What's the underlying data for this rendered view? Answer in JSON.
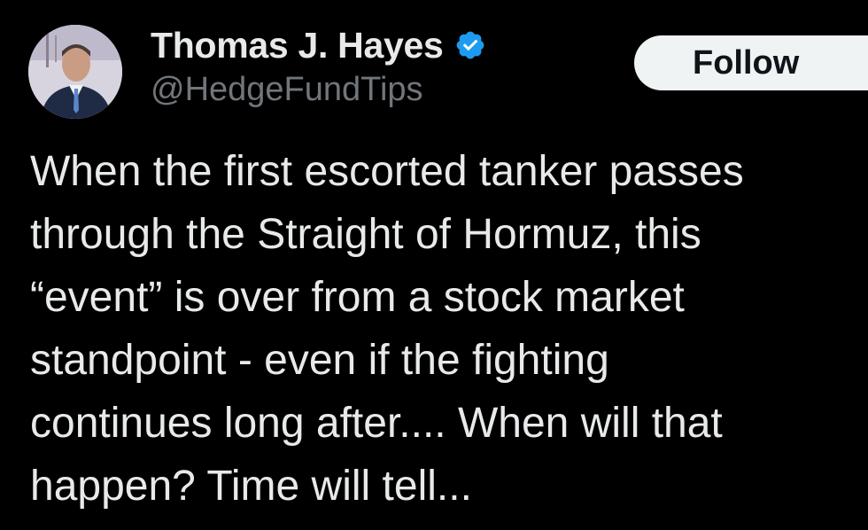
{
  "author": {
    "display_name": "Thomas J. Hayes",
    "handle": "@HedgeFundTips",
    "verified_icon": "verified-badge-icon",
    "avatar_icon": "avatar-photo"
  },
  "follow": {
    "label": "Follow"
  },
  "tweet": {
    "lines": [
      "When the first escorted tanker passes",
      "through the Straight of Hormuz, this",
      "“event” is over from a stock market",
      "standpoint - even if the fighting",
      "continues long after.... When will that",
      "happen?  Time will tell..."
    ]
  },
  "colors": {
    "background": "#000000",
    "text_primary": "#e7e9ea",
    "text_secondary": "#71767b",
    "verified_blue": "#1d9bf0",
    "follow_bg": "#eff3f4",
    "follow_text": "#0f1419"
  }
}
